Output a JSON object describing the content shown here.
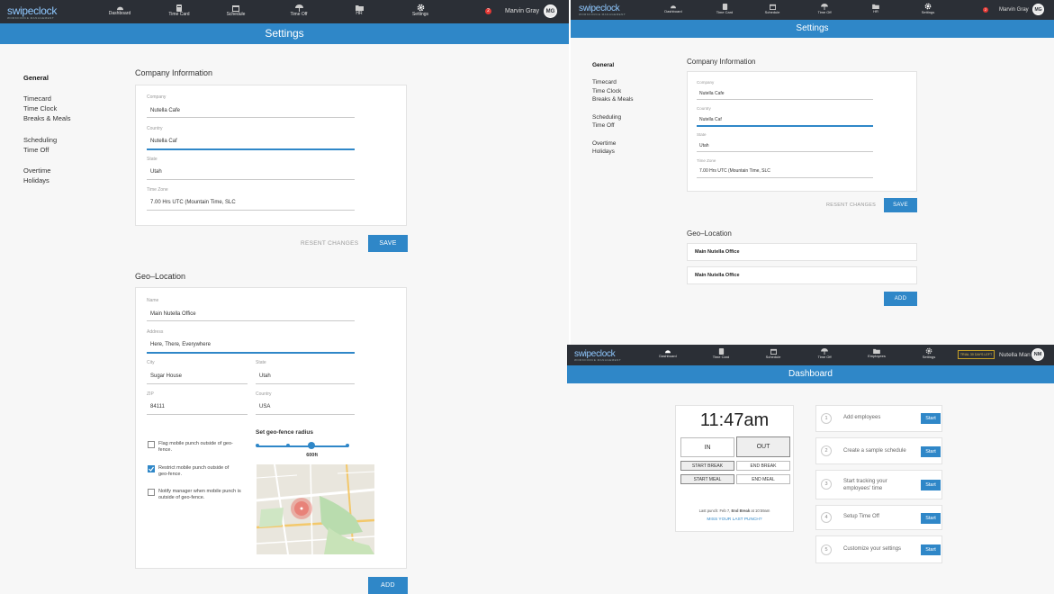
{
  "brand": {
    "name": "swipeclock",
    "tagline": "WORKFORCE MANAGEMENT"
  },
  "nav": {
    "dashboard": "Dashboard",
    "timecard": "Time Card",
    "schedule": "Schedule",
    "timeoff": "Time Off",
    "hr": "HR",
    "employees": "Employees",
    "settings": "Settings"
  },
  "user": {
    "name": "Marvin Gray",
    "initials": "MG",
    "badge": "2"
  },
  "user2": {
    "name": "Nutella Man",
    "initials": "NM",
    "trial": "TRIAL 30 DAYS LEFT"
  },
  "settings": {
    "title": "Settings",
    "sidebar": {
      "general": "General",
      "timecard": "Timecard",
      "timeclock": "Time Clock",
      "breaks": "Breaks & Meals",
      "scheduling": "Scheduling",
      "timeoff": "Time Off",
      "overtime": "Overtime",
      "holidays": "Holidays"
    },
    "company": {
      "heading": "Company Information",
      "company_label": "Company",
      "company": "Nutella Cafe",
      "country_label": "Country",
      "country": "Nutella Caf",
      "state_label": "State",
      "state": "Utah",
      "tz_label": "Time Zone",
      "tz": "7.00 Hrs UTC (Mountain Time, SLC"
    },
    "resent": "RESENT CHANGES",
    "save": "SAVE",
    "geo": {
      "heading": "Geo–Location",
      "name_label": "Name",
      "name": "Main Nutella Office",
      "address_label": "Address",
      "address": "Here, There, Everywhere",
      "city_label": "City",
      "city": "Sugar House",
      "state_label": "State",
      "state": "Utah",
      "zip_label": "ZIP",
      "zip": "84111",
      "country_label": "Country",
      "country": "USA",
      "chk1": "Flag mobile punch outside of geo-fence.",
      "chk2": "Restrict mobile punch outside of geo-fence.",
      "chk3": "Notify manager when mobile punch is outside of geo-fence.",
      "radius_title": "Set geo-fence radius",
      "radius_value": "600ft",
      "radius_level": 0.6,
      "chk1_checked": false,
      "chk2_checked": true,
      "chk3_checked": false
    },
    "add": "ADD",
    "geo_list": [
      "Main Nutella Office",
      "Main Nutella Office"
    ]
  },
  "dashboard": {
    "title": "Dashboard",
    "time": "11:47am",
    "in": "IN",
    "out": "OUT",
    "start_break": "START BREAK",
    "end_break": "END BREAK",
    "start_meal": "START MEAL",
    "end_meal": "END MEAL",
    "last_punch_prefix": "Last punch: Feb 7, ",
    "last_punch_bold": "End Break",
    "last_punch_suffix": " at 10:59am",
    "missed": "MISS YOUR LAST PUNCH?",
    "steps": [
      {
        "n": "1",
        "text": "Add employees"
      },
      {
        "n": "2",
        "text": "Create a sample schedule"
      },
      {
        "n": "3",
        "text": "Start tracking your employees' time"
      },
      {
        "n": "4",
        "text": "Setup Time Off"
      },
      {
        "n": "5",
        "text": "Customize your settings"
      }
    ],
    "start": "Start"
  },
  "colors": {
    "nav": "#2b2f36",
    "accent": "#2f87c8",
    "badge": "#e53935"
  }
}
